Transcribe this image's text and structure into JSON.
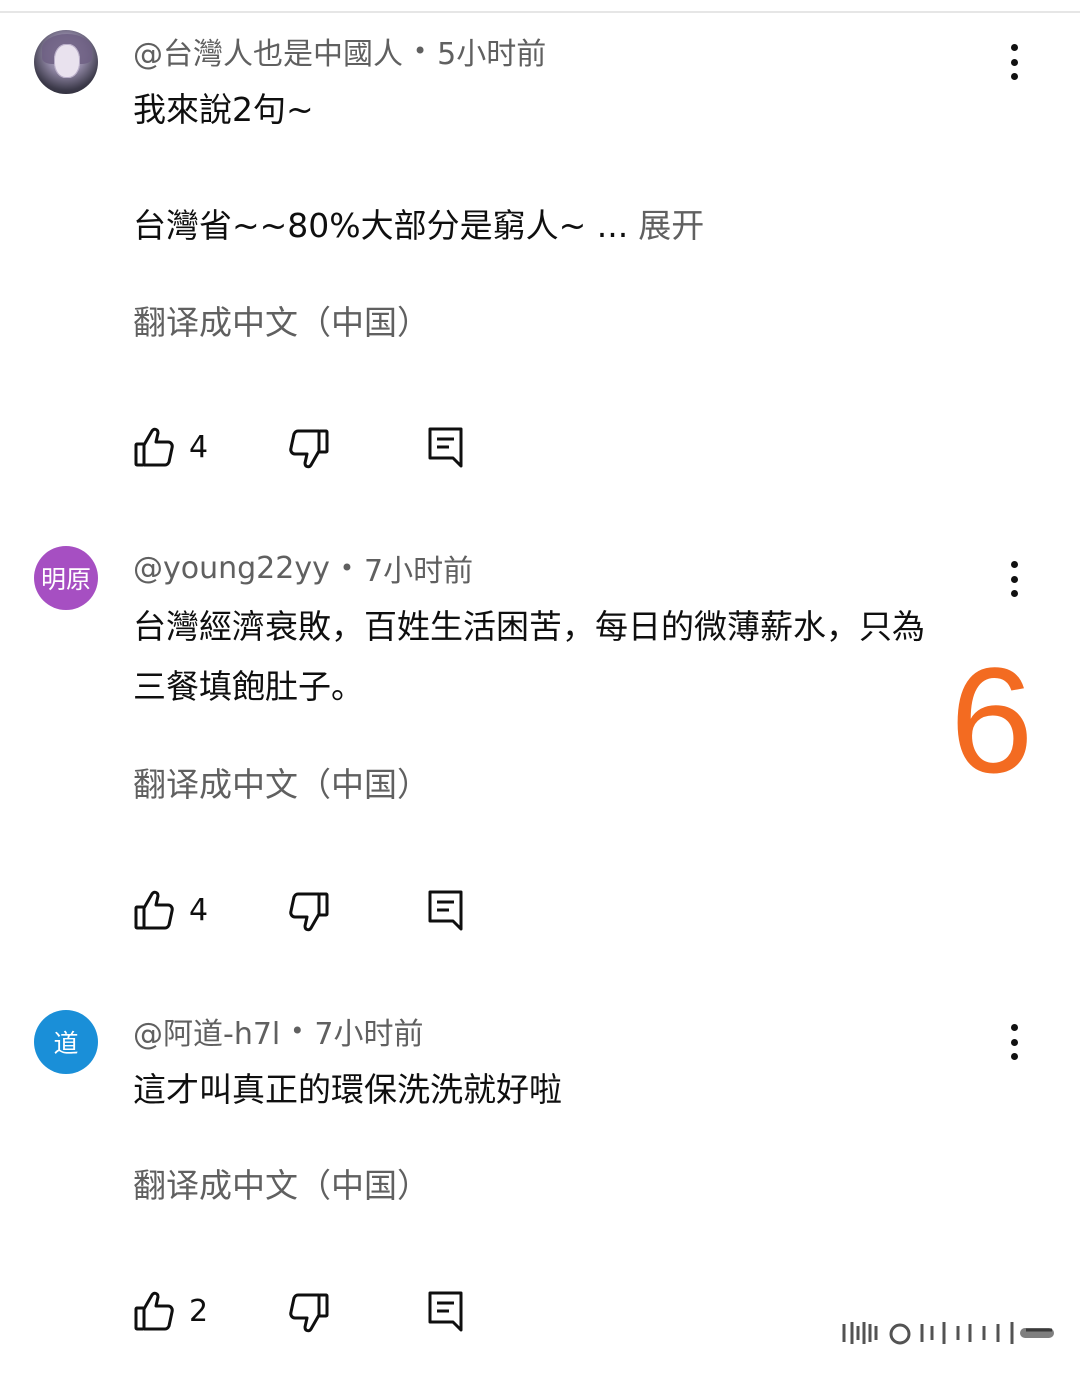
{
  "comments": [
    {
      "avatar_text": "",
      "avatar_color": "#7a6f8f",
      "username": "@台灣人也是中國人",
      "time": "5小时前",
      "lines": [
        "我來說2句~",
        "",
        "台灣省~~80%大部分是窮人~ ..."
      ],
      "expand_label": "展开",
      "translate_label": "翻译成中文（中国）",
      "likes": "4"
    },
    {
      "avatar_text": "明原",
      "avatar_color": "#a64fc2",
      "username": "@young22yy",
      "time": "7小时前",
      "lines": [
        "台灣經濟衰敗，百姓生活困苦，每日的微薄薪水，只為",
        "三餐填飽肚子。"
      ],
      "translate_label": "翻译成中文（中国）",
      "likes": "4"
    },
    {
      "avatar_text": "道",
      "avatar_color": "#1a8fd8",
      "username": "@阿道-h7l",
      "time": "7小时前",
      "lines": [
        "這才叫真正的環保洗洗就好啦"
      ],
      "translate_label": "翻译成中文（中国）",
      "likes": "2"
    }
  ],
  "overlay_number": "6",
  "colors": {
    "accent_orange": "#f36b21",
    "secondary_text": "#606060"
  }
}
